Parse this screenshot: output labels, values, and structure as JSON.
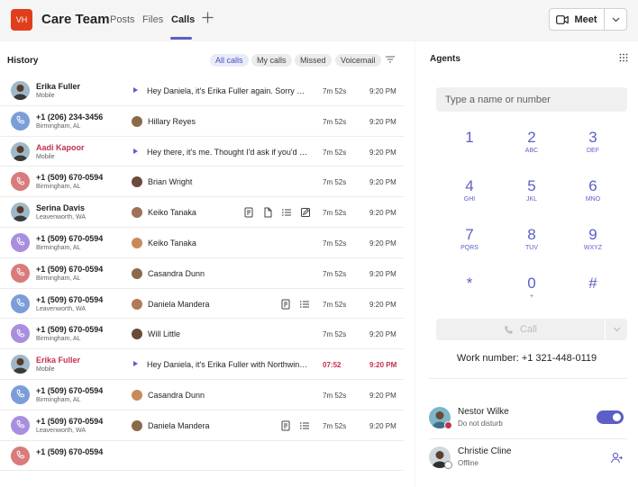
{
  "header": {
    "team_initials": "VH",
    "team_name": "Care Team",
    "tabs": [
      {
        "label": "Posts"
      },
      {
        "label": "Files"
      },
      {
        "label": "Calls"
      }
    ],
    "add_tab_icon": "plus-icon",
    "meet_label": "Meet"
  },
  "history": {
    "title": "History",
    "filters": [
      {
        "label": "All calls"
      },
      {
        "label": "My calls"
      },
      {
        "label": "Missed"
      },
      {
        "label": "Voicemail"
      }
    ],
    "rows": [
      {
        "caller": "Erika Fuller",
        "sub": "Mobile",
        "type": "voicemail",
        "text": "Hey Daniela, it's Erika Fuller again. Sorry we couldn't connect",
        "duration": "7m 52s",
        "time": "9:20 PM",
        "missed": false
      },
      {
        "caller": "+1 (206) 234-3456",
        "sub": "Birmingham, AL",
        "type": "person",
        "text": "Hillary Reyes",
        "duration": "7m 52s",
        "time": "9:20 PM",
        "missed": false
      },
      {
        "caller": "Aadi Kapoor",
        "sub": "Mobile",
        "type": "voicemail",
        "text": "Hey there, it's me. Thought I'd ask if you'd like to meet",
        "duration": "7m 52s",
        "time": "9:20 PM",
        "missed": true
      },
      {
        "caller": "+1 (509) 670-0594",
        "sub": "Birmingham, AL",
        "type": "person",
        "text": "Brian Wright",
        "duration": "7m 52s",
        "time": "9:20 PM",
        "missed": false
      },
      {
        "caller": "Serina Davis",
        "sub": "Leavenworth, WA",
        "type": "person",
        "text": "Keiko Tanaka",
        "duration": "7m 52s",
        "time": "9:20 PM",
        "missed": false
      },
      {
        "caller": "+1 (509) 670-0594",
        "sub": "Birmingham, AL",
        "type": "person",
        "text": "Keiko Tanaka",
        "duration": "7m 52s",
        "time": "9:20 PM",
        "missed": false
      },
      {
        "caller": "+1 (509) 670-0594",
        "sub": "Birmingham, AL",
        "type": "person",
        "text": "Casandra Dunn",
        "duration": "7m 52s",
        "time": "9:20 PM",
        "missed": false
      },
      {
        "caller": "+1 (509) 670-0594",
        "sub": "Leavenworth, WA",
        "type": "person",
        "text": "Daniela Mandera",
        "duration": "7m 52s",
        "time": "9:20 PM",
        "missed": false
      },
      {
        "caller": "+1 (509) 670-0594",
        "sub": "Birmingham, AL",
        "type": "person",
        "text": "Will Little",
        "duration": "7m 52s",
        "time": "9:20 PM",
        "missed": false
      },
      {
        "caller": "Erika Fuller",
        "sub": "Mobile",
        "type": "voicemail",
        "text": "Hey Daniela, it's Erika Fuller with Northwind Traders",
        "duration": "07:52",
        "time": "9:20 PM",
        "missed": true
      },
      {
        "caller": "+1 (509) 670-0594",
        "sub": "Birmingham, AL",
        "type": "person",
        "text": "Casandra Dunn",
        "duration": "7m 52s",
        "time": "9:20 PM",
        "missed": false
      },
      {
        "caller": "+1 (509) 670-0594",
        "sub": "Leavenworth, WA",
        "type": "person",
        "text": "Daniela Mandera",
        "duration": "7m 52s",
        "time": "9:20 PM",
        "missed": false
      },
      {
        "caller": "+1 (509) 670-0594",
        "sub": "",
        "type": "person",
        "text": "",
        "duration": "",
        "time": "",
        "missed": false
      }
    ]
  },
  "agents": {
    "title": "Agents",
    "dial_placeholder": "Type a name or number",
    "keypad": [
      {
        "num": "1",
        "letters": ""
      },
      {
        "num": "2",
        "letters": "ABC"
      },
      {
        "num": "3",
        "letters": "DEF"
      },
      {
        "num": "4",
        "letters": "GHI"
      },
      {
        "num": "5",
        "letters": "JKL"
      },
      {
        "num": "6",
        "letters": "MNO"
      },
      {
        "num": "7",
        "letters": "PQRS"
      },
      {
        "num": "8",
        "letters": "TUV"
      },
      {
        "num": "9",
        "letters": "WXYZ"
      },
      {
        "num": "*",
        "letters": ""
      },
      {
        "num": "0",
        "letters": "+"
      },
      {
        "num": "#",
        "letters": ""
      }
    ],
    "call_label": "Call",
    "work_number": "Work number: +1 321-448-0119",
    "people": [
      {
        "name": "Nestor Wilke",
        "status": "Do not disturb",
        "status_color": "#c4314b",
        "toggle_on": true
      },
      {
        "name": "Christie Cline",
        "status": "Offline",
        "status_color": "#8a8a8a",
        "toggle_on": false
      }
    ]
  },
  "colors": {
    "accent": "#5b5fc7",
    "missed": "#c4314b",
    "team_avatar": "#e03e1b"
  }
}
